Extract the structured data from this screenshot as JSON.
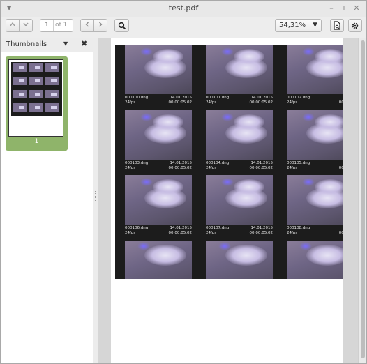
{
  "window": {
    "title": "test.pdf"
  },
  "toolbar": {
    "page_number": "1",
    "page_total": "of 1",
    "zoom": "54,31%"
  },
  "sidebar": {
    "title": "Thumbnails",
    "thumb_label": "1"
  },
  "frames": [
    {
      "name": "000100.dng",
      "date": "14.01.2015",
      "fps": "24fps",
      "tc": "00:00:05.02"
    },
    {
      "name": "000101.dng",
      "date": "14.01.2015",
      "fps": "24fps",
      "tc": "00:00:05.02"
    },
    {
      "name": "000102.dng",
      "date": "14.01",
      "fps": "24fps",
      "tc": "00:00:0"
    },
    {
      "name": "000103.dng",
      "date": "14.01.2015",
      "fps": "24fps",
      "tc": "00:00:05.02"
    },
    {
      "name": "000104.dng",
      "date": "14.01.2015",
      "fps": "24fps",
      "tc": "00:00:05.02"
    },
    {
      "name": "000105.dng",
      "date": "14.01",
      "fps": "24fps",
      "tc": "00:00:0"
    },
    {
      "name": "000106.dng",
      "date": "14.01.2015",
      "fps": "24fps",
      "tc": "00:00:05.02"
    },
    {
      "name": "000107.dng",
      "date": "14.01.2015",
      "fps": "24fps",
      "tc": "00:00:05.02"
    },
    {
      "name": "000108.dng",
      "date": "14.01",
      "fps": "24fps",
      "tc": "00:00:0"
    }
  ]
}
